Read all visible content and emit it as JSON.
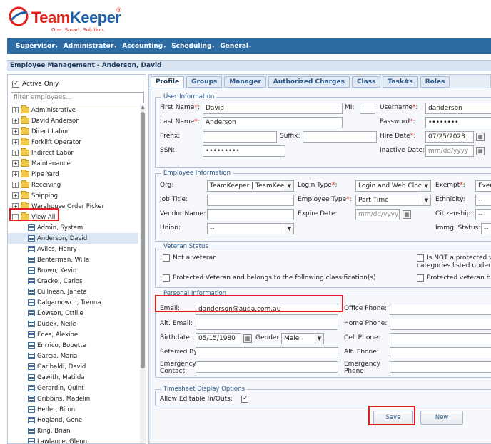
{
  "brand": {
    "team": "Team",
    "keeper": "Keeper",
    "reg": "®",
    "tagline": "One. Smart. Solution."
  },
  "nav": [
    {
      "label": "Supervisor"
    },
    {
      "label": "Administrator"
    },
    {
      "label": "Accounting"
    },
    {
      "label": "Scheduling"
    },
    {
      "label": "General"
    }
  ],
  "page_title": "Employee Management - Anderson, David",
  "left": {
    "active_only_label": "Active Only",
    "active_only_checked": true,
    "filter_placeholder": "filter employees...",
    "folders": [
      "Administrative",
      "David Anderson",
      "Direct Labor",
      "Forklift Operator",
      "Indirect Labor",
      "Maintenance",
      "Pipe Yard",
      "Receiving",
      "Shipping",
      "Warehouse Order Picker"
    ],
    "view_all_label": "View All",
    "employees": [
      "Admin, System",
      "Anderson, David",
      "Aviles, Henry",
      "Benterman, Willa",
      "Brown, Kevin",
      "Crackel, Carlos",
      "Cullnean, Janeta",
      "Dalgarnowch, Trenna",
      "Dowson, Ottilie",
      "Dudek, Neile",
      "Edes, Alexine",
      "Enrrico, Bobette",
      "Garcia, Maria",
      "Garibaldi, David",
      "Gawith, Matilda",
      "Gerardin, Quint",
      "Gribbins, Madelin",
      "Heifer, Biron",
      "Hogland, Gene",
      "King, Brian",
      "Lawlance, Glenn"
    ],
    "selected_employee": "Anderson, David"
  },
  "tabs": [
    "Profile",
    "Groups",
    "Manager",
    "Authorized Charges",
    "Class",
    "Task#s",
    "Roles"
  ],
  "active_tab": "Profile",
  "user_info": {
    "legend": "User Information",
    "first_name_label": "First Name",
    "first_name": "David",
    "mi_label": "MI:",
    "mi": "",
    "username_label": "Username",
    "username": "danderson",
    "last_name_label": "Last Name",
    "last_name": "Anderson",
    "password_label": "Password",
    "password": "••••••••",
    "prefix_label": "Prefix:",
    "prefix": "",
    "suffix_label": "Suffix:",
    "suffix": "",
    "hire_date_label": "Hire Date",
    "hire_date": "07/25/2023",
    "ssn_label": "SSN:",
    "ssn": "•••••••••",
    "inactive_date_label": "Inactive Date:",
    "inactive_date_placeholder": "mm/dd/yyyy"
  },
  "employee_info": {
    "legend": "Employee Information",
    "org_label": "Org:",
    "org": "TeamKeeper | TeamKeepe",
    "login_type_label": "Login Type",
    "login_type": "Login and Web Clock",
    "exempt_label": "Exempt",
    "exempt": "Exem",
    "job_title_label": "Job Title:",
    "job_title": "",
    "employee_type_label": "Employee Type",
    "employee_type": "Part Time",
    "ethnicity_label": "Ethnicity:",
    "ethnicity": "--",
    "vendor_name_label": "Vendor Name:",
    "vendor_name": "",
    "expire_date_label": "Expire Date:",
    "expire_date_placeholder": "mm/dd/yyyy",
    "citizenship_label": "Citizenship:",
    "citizenship": "--",
    "union_label": "Union:",
    "union": "--",
    "immg_status_label": "Immg. Status:",
    "immg_status": "--"
  },
  "veteran": {
    "legend": "Veteran Status",
    "not_veteran": "Not a veteran",
    "not_protected_line1": "Is NOT a protected vete",
    "not_protected_line2": "categories listed under Pro",
    "protected_classification": "Protected Veteran and belongs to the following classification(s)",
    "protected_but": "Protected veteran but c"
  },
  "personal": {
    "legend": "Personal Information",
    "email_label": "Email:",
    "email": "danderson@auda.com.au",
    "office_phone_label": "Office Phone:",
    "office_phone": "",
    "alt_email_label": "Alt. Email:",
    "alt_email": "",
    "home_phone_label": "Home Phone:",
    "home_phone": "",
    "birthdate_label": "Birthdate:",
    "birthdate": "05/15/1980",
    "gender_label": "Gender:",
    "gender": "Male",
    "cell_phone_label": "Cell Phone:",
    "cell_phone": "",
    "referred_by_label": "Referred By:",
    "referred_by": "",
    "alt_phone_label": "Alt. Phone:",
    "alt_phone": "",
    "emergency_contact_label_1": "Emergency",
    "emergency_contact_label_2": "Contact:",
    "emergency_phone_label_1": "Emergency",
    "emergency_phone_label_2": "Phone:"
  },
  "timesheet": {
    "legend": "Timesheet Display Options",
    "allow_editable_label": "Allow Editable In/Outs:",
    "allow_editable_checked": true
  },
  "buttons": {
    "save": "Save",
    "new": "New"
  },
  "colors": {
    "nav_bg": "#2e6ba3",
    "brand_red": "#e0231a",
    "brand_blue": "#1f5fa8",
    "highlight": "#e02020"
  }
}
